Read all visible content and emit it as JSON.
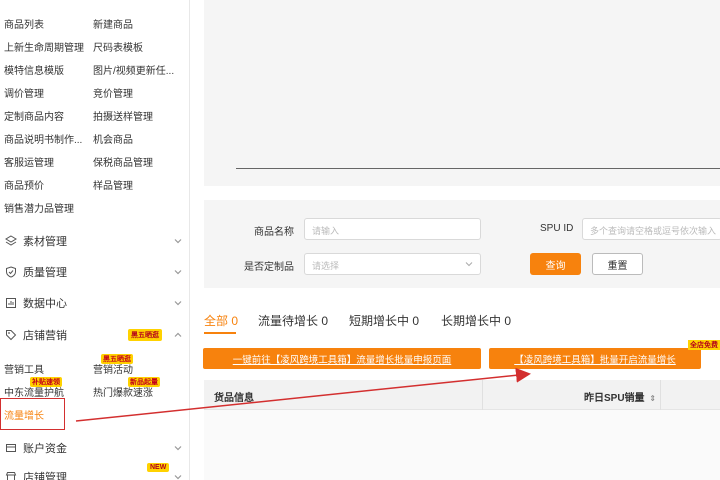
{
  "sidebar": {
    "grid_items": [
      [
        "商品列表",
        "新建商品"
      ],
      [
        "上新生命周期管理",
        "尺码表模板"
      ],
      [
        "模特信息模版",
        "图片/视频更新任..."
      ],
      [
        "调价管理",
        "竞价管理"
      ],
      [
        "定制商品内容",
        "拍摄送样管理"
      ],
      [
        "商品说明书制作...",
        "机会商品"
      ],
      [
        "客服运管理",
        "保税商品管理"
      ],
      [
        "商品预价",
        "样品管理"
      ],
      [
        "销售潜力品管理",
        ""
      ]
    ],
    "menus": {
      "material": "素材管理",
      "quality": "质量管理",
      "data": "数据中心",
      "marketing": "店铺营销",
      "account": "账户资金",
      "store": "店铺管理"
    },
    "marketing_badge": "黑五晒逛",
    "marketing_sub": {
      "tools": "营销工具",
      "activity": "营销活动",
      "activity_tag": "黑五晒逛",
      "center": "中东流量护航",
      "center_tag": "补贴速领",
      "hot": "热门爆款速涨",
      "hot_tag": "新品起量",
      "growth": "流量增长"
    },
    "store_badge": "NEW"
  },
  "filter": {
    "product_name_label": "商品名称",
    "product_name_placeholder": "请输入",
    "spu_label": "SPU ID",
    "spu_placeholder": "多个查询请空格或逗号依次输入",
    "custom_label": "是否定制品",
    "custom_placeholder": "请选择",
    "query_btn": "查询",
    "reset_btn": "重置"
  },
  "tabs": [
    {
      "label": "全部 0",
      "active": true
    },
    {
      "label": "流量待增长 0",
      "active": false
    },
    {
      "label": "短期增长中 0",
      "active": false
    },
    {
      "label": "长期增长中 0",
      "active": false
    }
  ],
  "actions": {
    "btn1": "一键前往【凌风跨境工具箱】流量增长批量申报页面",
    "btn2": "【凌风跨境工具箱】批量开启流量增长",
    "btn2_tag": "全店免费"
  },
  "table": {
    "col_product": "货品信息",
    "col_sales": "昨日SPU销量"
  },
  "colors": {
    "accent": "#f7820d",
    "highlight": "#d32f2f",
    "badge": "#ffd200"
  }
}
